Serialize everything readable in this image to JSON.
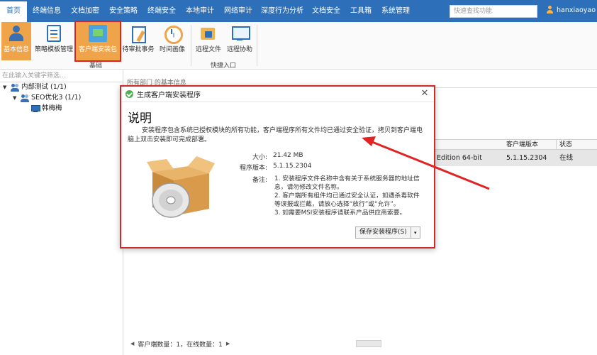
{
  "menubar": {
    "items": [
      "首页",
      "终端信息",
      "文档加密",
      "安全策略",
      "终端安全",
      "本地审计",
      "网络审计",
      "深度行为分析",
      "文档安全",
      "工具箱",
      "系统管理"
    ],
    "search_placeholder": "快速查找功能",
    "username": "hanxiaoyao",
    "colors": {
      "bar": "#2d6fb8",
      "accent": "#f0a44a",
      "highlight_border": "#d62626"
    }
  },
  "ribbon": {
    "buttons": [
      {
        "label": "基本信息",
        "icon": "person-icon"
      },
      {
        "label": "策略模板管理",
        "icon": "document-icon"
      },
      {
        "label": "客户端安装包",
        "icon": "package-icon"
      },
      {
        "label": "待审批事务",
        "icon": "approval-icon"
      },
      {
        "label": "时间画像",
        "icon": "clock-icon"
      },
      {
        "label": "远程文件",
        "icon": "folder-icon"
      },
      {
        "label": "远程协助",
        "icon": "monitor-icon"
      }
    ],
    "groups": [
      "基础",
      "快捷入口"
    ]
  },
  "tree": {
    "search_placeholder": "在此输入关键字筛选...",
    "nodes": [
      {
        "label": "内部测试 (1/1)",
        "toggle": "▼"
      },
      {
        "label": "SEO优化3 (1/1)",
        "toggle": "▼"
      },
      {
        "label": "韩梅梅",
        "toggle": ""
      }
    ]
  },
  "main": {
    "breadcrumb": "所有部门 的基本信息",
    "table": {
      "headers": [
        "客户端版本",
        "状态"
      ],
      "row": {
        "os": "Edition 64-bit",
        "version": "5.1.15.2304",
        "status": "在线"
      }
    },
    "status_bar": {
      "client_count": "客户端数量：1，在线数量：1"
    }
  },
  "dialog": {
    "title": "生成客户端安装程序",
    "close": "✕",
    "heading": "说明",
    "description": "安装程序包含系统已授权模块的所有功能，客户端程序所有文件均已通过安全验证，拷贝到客户端电脑上双击安装即可完成部署。",
    "size_label": "大小:",
    "size_value": "21.42 MB",
    "version_label": "程序版本:",
    "version_value": "5.1.15.2304",
    "notes_label": "备注:",
    "notes": [
      "1. 安装程序文件名称中含有关于系统服务器的地址信息，请勿修改文件名称。",
      "2. 客户端所有组件均已通过安全认证，如遇杀毒软件等误报或拦截，请放心选择“放行”或“允许”。",
      "3. 如需要MSI安装程序请联系产品供应商索要。"
    ],
    "save_button": "保存安装程序(S)",
    "dropdown": "▾"
  }
}
